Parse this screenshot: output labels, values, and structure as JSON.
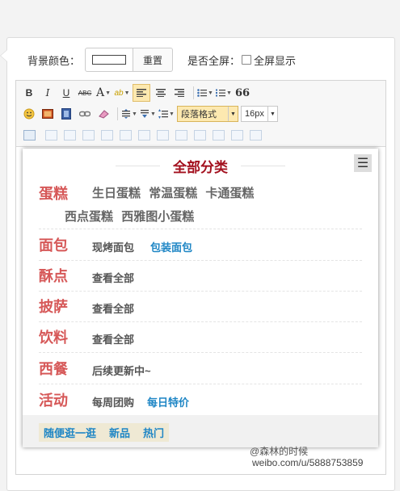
{
  "topbar": {
    "bg_label": "背景颜色：",
    "reset": "重置",
    "fullscreen_label": "是否全屏：",
    "fullscreen_option": "全屏显示"
  },
  "toolbar": {
    "bold": "B",
    "italic": "I",
    "underline": "U",
    "strike": "ABC",
    "fontcolor": "A",
    "highlight": "ab",
    "quote": "66",
    "format_value": "段落格式",
    "fontsize_value": "16px"
  },
  "page": {
    "title": "全部分类",
    "menu_icon": "hamburger-icon",
    "categories": [
      {
        "name": "蛋糕",
        "row1": [
          "生日蛋糕",
          "常温蛋糕",
          "卡通蛋糕"
        ],
        "row2": [
          "西点蛋糕",
          "西雅图小蛋糕"
        ]
      },
      {
        "name": "面包",
        "items": [
          "现烤面包",
          "包装面包"
        ]
      },
      {
        "name": "酥点",
        "items": [
          "查看全部"
        ]
      },
      {
        "name": "披萨",
        "items": [
          "查看全部"
        ]
      },
      {
        "name": "饮料",
        "items": [
          "查看全部"
        ]
      },
      {
        "name": "西餐",
        "items": [
          "后续更新中~"
        ]
      },
      {
        "name": "活动",
        "items": [
          "每周团购",
          "每日特价"
        ]
      }
    ],
    "footer": [
      "随便逛一逛",
      "新品",
      "热门"
    ]
  },
  "watermark": {
    "line1": "@森林的时候",
    "line2": "weibo.com/u/5888753859"
  },
  "colors": {
    "title": "#a3101e",
    "category": "#d65858",
    "link": "#1f86c5",
    "active_tool": "#fde9b0"
  }
}
